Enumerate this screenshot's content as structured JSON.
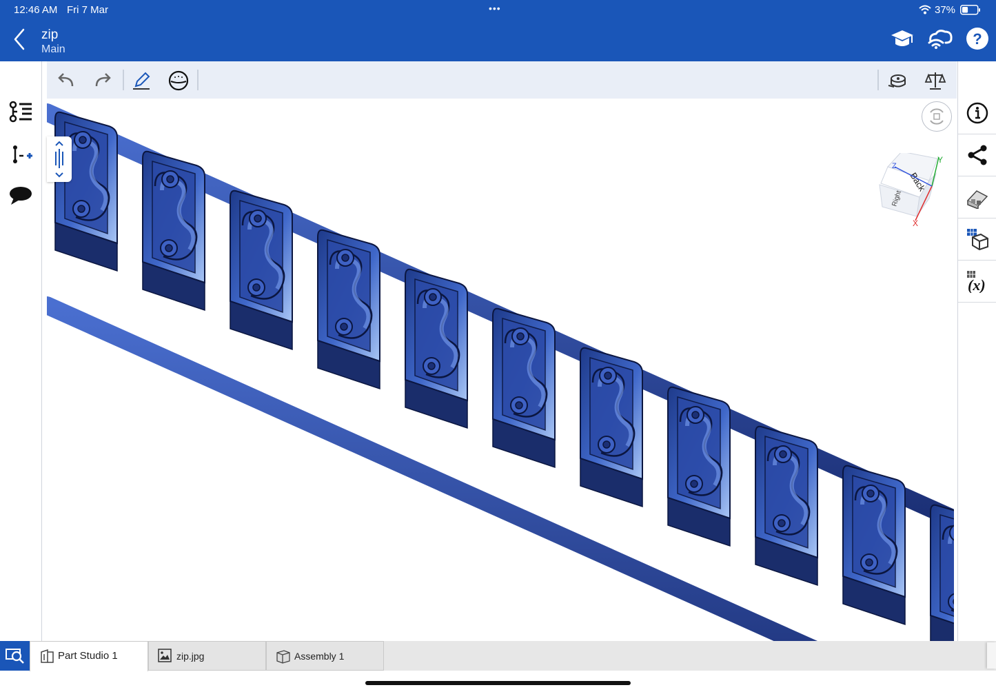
{
  "status_bar": {
    "time": "12:46 AM",
    "date": "Fri 7 Mar",
    "dots": "•••",
    "battery": "37%",
    "battery_level": 0.37
  },
  "header": {
    "title": "zip",
    "subtitle": "Main",
    "icons": [
      "back-chevron-icon",
      "graduation-cap-icon",
      "cloud-sync-icon",
      "help-icon"
    ]
  },
  "left_sidebar": {
    "icons": [
      "feature-list-icon",
      "insert-feature-icon",
      "comment-icon"
    ]
  },
  "toolbar": {
    "icons": [
      "undo-icon",
      "redo-icon",
      "sketch-pencil-icon",
      "view-face-icon",
      "measure-tape-icon",
      "mass-properties-icon"
    ]
  },
  "viewport": {
    "view_cube": {
      "face_top": "Back",
      "face_left": "Right",
      "axis_x": "X",
      "axis_y": "Y",
      "axis_z": "Z"
    }
  },
  "right_sidebar": {
    "icons": [
      "info-icon",
      "share-icon",
      "appearance-icon",
      "configurations-icon",
      "variables-icon"
    ]
  },
  "tabs": [
    {
      "label": "Part Studio 1",
      "icon": "part-studio-icon",
      "active": true
    },
    {
      "label": "zip.jpg",
      "icon": "image-icon",
      "active": false
    },
    {
      "label": "Assembly 1",
      "icon": "assembly-icon",
      "active": false
    }
  ],
  "colors": {
    "brand_blue": "#1a56b8",
    "model_dark": "#1e3a8a",
    "model_light": "#a9c6f5"
  }
}
